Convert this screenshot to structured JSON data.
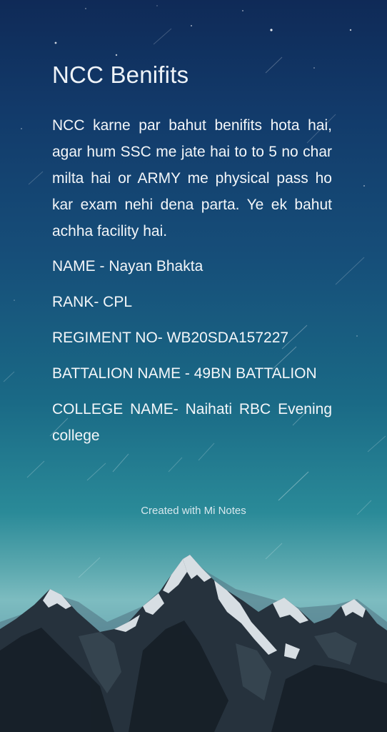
{
  "note": {
    "title": "NCC Benifits",
    "body": "NCC karne par bahut benifits hota hai, agar hum SSC me jate hai to to 5 no char milta hai or ARMY me physical pass ho kar exam nehi dena parta. Ye ek bahut achha facility hai.",
    "fields": [
      "NAME - Nayan Bhakta",
      "RANK- CPL",
      "REGIMENT NO- WB20SDA157227",
      "BATTALION NAME - 49BN BATTALION",
      "COLLEGE NAME- Naihati RBC Evening college"
    ]
  },
  "footer": {
    "watermark": "Created with Mi Notes"
  },
  "theme": {
    "text_color": "#ffffff",
    "sky_top": "#0f2a57",
    "sky_horizon": "#7dbcc0",
    "mountain_dark": "#1e2a35",
    "snow": "#e8eef2"
  }
}
